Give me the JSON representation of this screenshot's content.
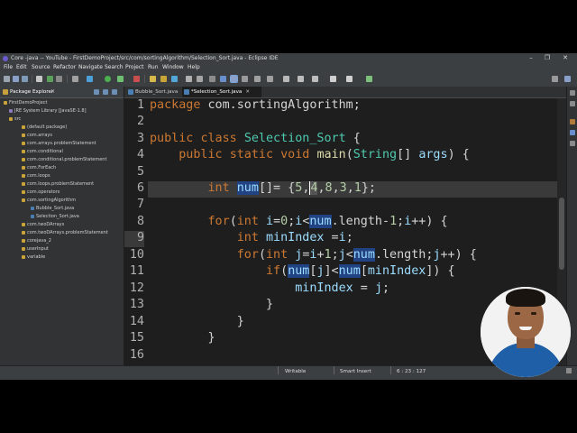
{
  "window": {
    "title": "Core -java -- YouTube - FirstDemoProject/src/com/sortingAlgorithm/Selection_Sort.java - Eclipse IDE",
    "controls": [
      "–",
      "❐",
      "✕"
    ]
  },
  "menu": [
    "File",
    "Edit",
    "Source",
    "Refactor",
    "Navigate",
    "Search",
    "Project",
    "Run",
    "Window",
    "Help"
  ],
  "package_explorer": {
    "tab_label": "Package Explorer",
    "close_glyph": "✕",
    "tree": [
      {
        "label": "FirstDemoProject",
        "depth": 0,
        "icon": "project-icon"
      },
      {
        "label": "JRE System Library [JavaSE-1.8]",
        "depth": 1,
        "icon": "library-icon"
      },
      {
        "label": "src",
        "depth": 1,
        "icon": "folder-icon"
      },
      {
        "label": "(default package)",
        "depth": 2,
        "icon": "package-icon"
      },
      {
        "label": "com.arrays",
        "depth": 2,
        "icon": "package-icon"
      },
      {
        "label": "com.arrays.problemStatement",
        "depth": 2,
        "icon": "package-icon"
      },
      {
        "label": "com.conditional",
        "depth": 2,
        "icon": "package-icon"
      },
      {
        "label": "com.conditional.problemStatement",
        "depth": 2,
        "icon": "package-icon"
      },
      {
        "label": "com.ForEach",
        "depth": 2,
        "icon": "package-icon"
      },
      {
        "label": "com.loops",
        "depth": 2,
        "icon": "package-icon"
      },
      {
        "label": "com.loops.problemStatement",
        "depth": 2,
        "icon": "package-icon"
      },
      {
        "label": "com.operators",
        "depth": 2,
        "icon": "package-icon"
      },
      {
        "label": "com.sortingAlgorithm",
        "depth": 2,
        "icon": "package-icon"
      },
      {
        "label": "Bubble_Sort.java",
        "depth": 3,
        "icon": "java-file-icon"
      },
      {
        "label": "Selection_Sort.java",
        "depth": 3,
        "icon": "java-file-icon"
      },
      {
        "label": "com.twoDArrays",
        "depth": 2,
        "icon": "package-icon"
      },
      {
        "label": "com.twoDArrays.problemStatement",
        "depth": 2,
        "icon": "package-icon"
      },
      {
        "label": "corejava_2",
        "depth": 2,
        "icon": "package-icon"
      },
      {
        "label": "userInput",
        "depth": 2,
        "icon": "package-icon"
      },
      {
        "label": "variable",
        "depth": 2,
        "icon": "package-icon"
      }
    ]
  },
  "editor": {
    "tabs": [
      {
        "label": "Bubble_Sort.java",
        "active": false
      },
      {
        "label": "*Selection_Sort.java",
        "active": true
      }
    ],
    "tab_close": "✕",
    "line_numbers": [
      "1",
      "2",
      "3",
      "4",
      "5",
      "6",
      "7",
      "8",
      "9",
      "10",
      "11",
      "12",
      "13",
      "14",
      "15",
      "16"
    ]
  },
  "status": {
    "mode": "Writable",
    "insert": "Smart Insert",
    "position": "6 : 23 : 127"
  },
  "colors": {
    "keyword": "#cc7832",
    "class": "#4ec9b0",
    "field": "#9cdcfe",
    "number": "#b5cea8",
    "selection": "#214283"
  }
}
